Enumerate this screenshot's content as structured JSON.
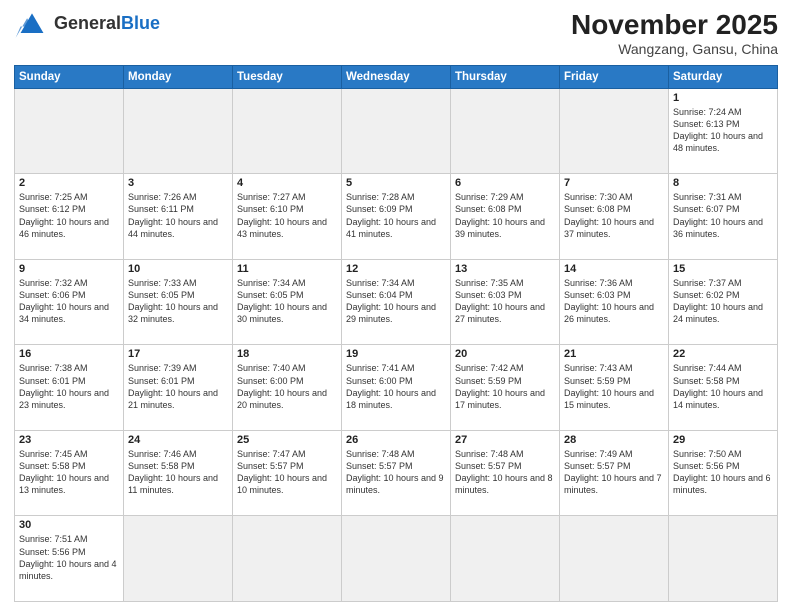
{
  "header": {
    "logo_general": "General",
    "logo_blue": "Blue",
    "month_title": "November 2025",
    "location": "Wangzang, Gansu, China"
  },
  "weekdays": [
    "Sunday",
    "Monday",
    "Tuesday",
    "Wednesday",
    "Thursday",
    "Friday",
    "Saturday"
  ],
  "days": {
    "1": {
      "sunrise": "7:24 AM",
      "sunset": "6:13 PM",
      "daylight": "10 hours and 48 minutes."
    },
    "2": {
      "sunrise": "7:25 AM",
      "sunset": "6:12 PM",
      "daylight": "10 hours and 46 minutes."
    },
    "3": {
      "sunrise": "7:26 AM",
      "sunset": "6:11 PM",
      "daylight": "10 hours and 44 minutes."
    },
    "4": {
      "sunrise": "7:27 AM",
      "sunset": "6:10 PM",
      "daylight": "10 hours and 43 minutes."
    },
    "5": {
      "sunrise": "7:28 AM",
      "sunset": "6:09 PM",
      "daylight": "10 hours and 41 minutes."
    },
    "6": {
      "sunrise": "7:29 AM",
      "sunset": "6:08 PM",
      "daylight": "10 hours and 39 minutes."
    },
    "7": {
      "sunrise": "7:30 AM",
      "sunset": "6:08 PM",
      "daylight": "10 hours and 37 minutes."
    },
    "8": {
      "sunrise": "7:31 AM",
      "sunset": "6:07 PM",
      "daylight": "10 hours and 36 minutes."
    },
    "9": {
      "sunrise": "7:32 AM",
      "sunset": "6:06 PM",
      "daylight": "10 hours and 34 minutes."
    },
    "10": {
      "sunrise": "7:33 AM",
      "sunset": "6:05 PM",
      "daylight": "10 hours and 32 minutes."
    },
    "11": {
      "sunrise": "7:34 AM",
      "sunset": "6:05 PM",
      "daylight": "10 hours and 30 minutes."
    },
    "12": {
      "sunrise": "7:34 AM",
      "sunset": "6:04 PM",
      "daylight": "10 hours and 29 minutes."
    },
    "13": {
      "sunrise": "7:35 AM",
      "sunset": "6:03 PM",
      "daylight": "10 hours and 27 minutes."
    },
    "14": {
      "sunrise": "7:36 AM",
      "sunset": "6:03 PM",
      "daylight": "10 hours and 26 minutes."
    },
    "15": {
      "sunrise": "7:37 AM",
      "sunset": "6:02 PM",
      "daylight": "10 hours and 24 minutes."
    },
    "16": {
      "sunrise": "7:38 AM",
      "sunset": "6:01 PM",
      "daylight": "10 hours and 23 minutes."
    },
    "17": {
      "sunrise": "7:39 AM",
      "sunset": "6:01 PM",
      "daylight": "10 hours and 21 minutes."
    },
    "18": {
      "sunrise": "7:40 AM",
      "sunset": "6:00 PM",
      "daylight": "10 hours and 20 minutes."
    },
    "19": {
      "sunrise": "7:41 AM",
      "sunset": "6:00 PM",
      "daylight": "10 hours and 18 minutes."
    },
    "20": {
      "sunrise": "7:42 AM",
      "sunset": "5:59 PM",
      "daylight": "10 hours and 17 minutes."
    },
    "21": {
      "sunrise": "7:43 AM",
      "sunset": "5:59 PM",
      "daylight": "10 hours and 15 minutes."
    },
    "22": {
      "sunrise": "7:44 AM",
      "sunset": "5:58 PM",
      "daylight": "10 hours and 14 minutes."
    },
    "23": {
      "sunrise": "7:45 AM",
      "sunset": "5:58 PM",
      "daylight": "10 hours and 13 minutes."
    },
    "24": {
      "sunrise": "7:46 AM",
      "sunset": "5:58 PM",
      "daylight": "10 hours and 11 minutes."
    },
    "25": {
      "sunrise": "7:47 AM",
      "sunset": "5:57 PM",
      "daylight": "10 hours and 10 minutes."
    },
    "26": {
      "sunrise": "7:48 AM",
      "sunset": "5:57 PM",
      "daylight": "10 hours and 9 minutes."
    },
    "27": {
      "sunrise": "7:48 AM",
      "sunset": "5:57 PM",
      "daylight": "10 hours and 8 minutes."
    },
    "28": {
      "sunrise": "7:49 AM",
      "sunset": "5:57 PM",
      "daylight": "10 hours and 7 minutes."
    },
    "29": {
      "sunrise": "7:50 AM",
      "sunset": "5:56 PM",
      "daylight": "10 hours and 6 minutes."
    },
    "30": {
      "sunrise": "7:51 AM",
      "sunset": "5:56 PM",
      "daylight": "10 hours and 4 minutes."
    }
  },
  "labels": {
    "sunrise_prefix": "Sunrise: ",
    "sunset_prefix": "Sunset: ",
    "daylight_prefix": "Daylight: "
  }
}
